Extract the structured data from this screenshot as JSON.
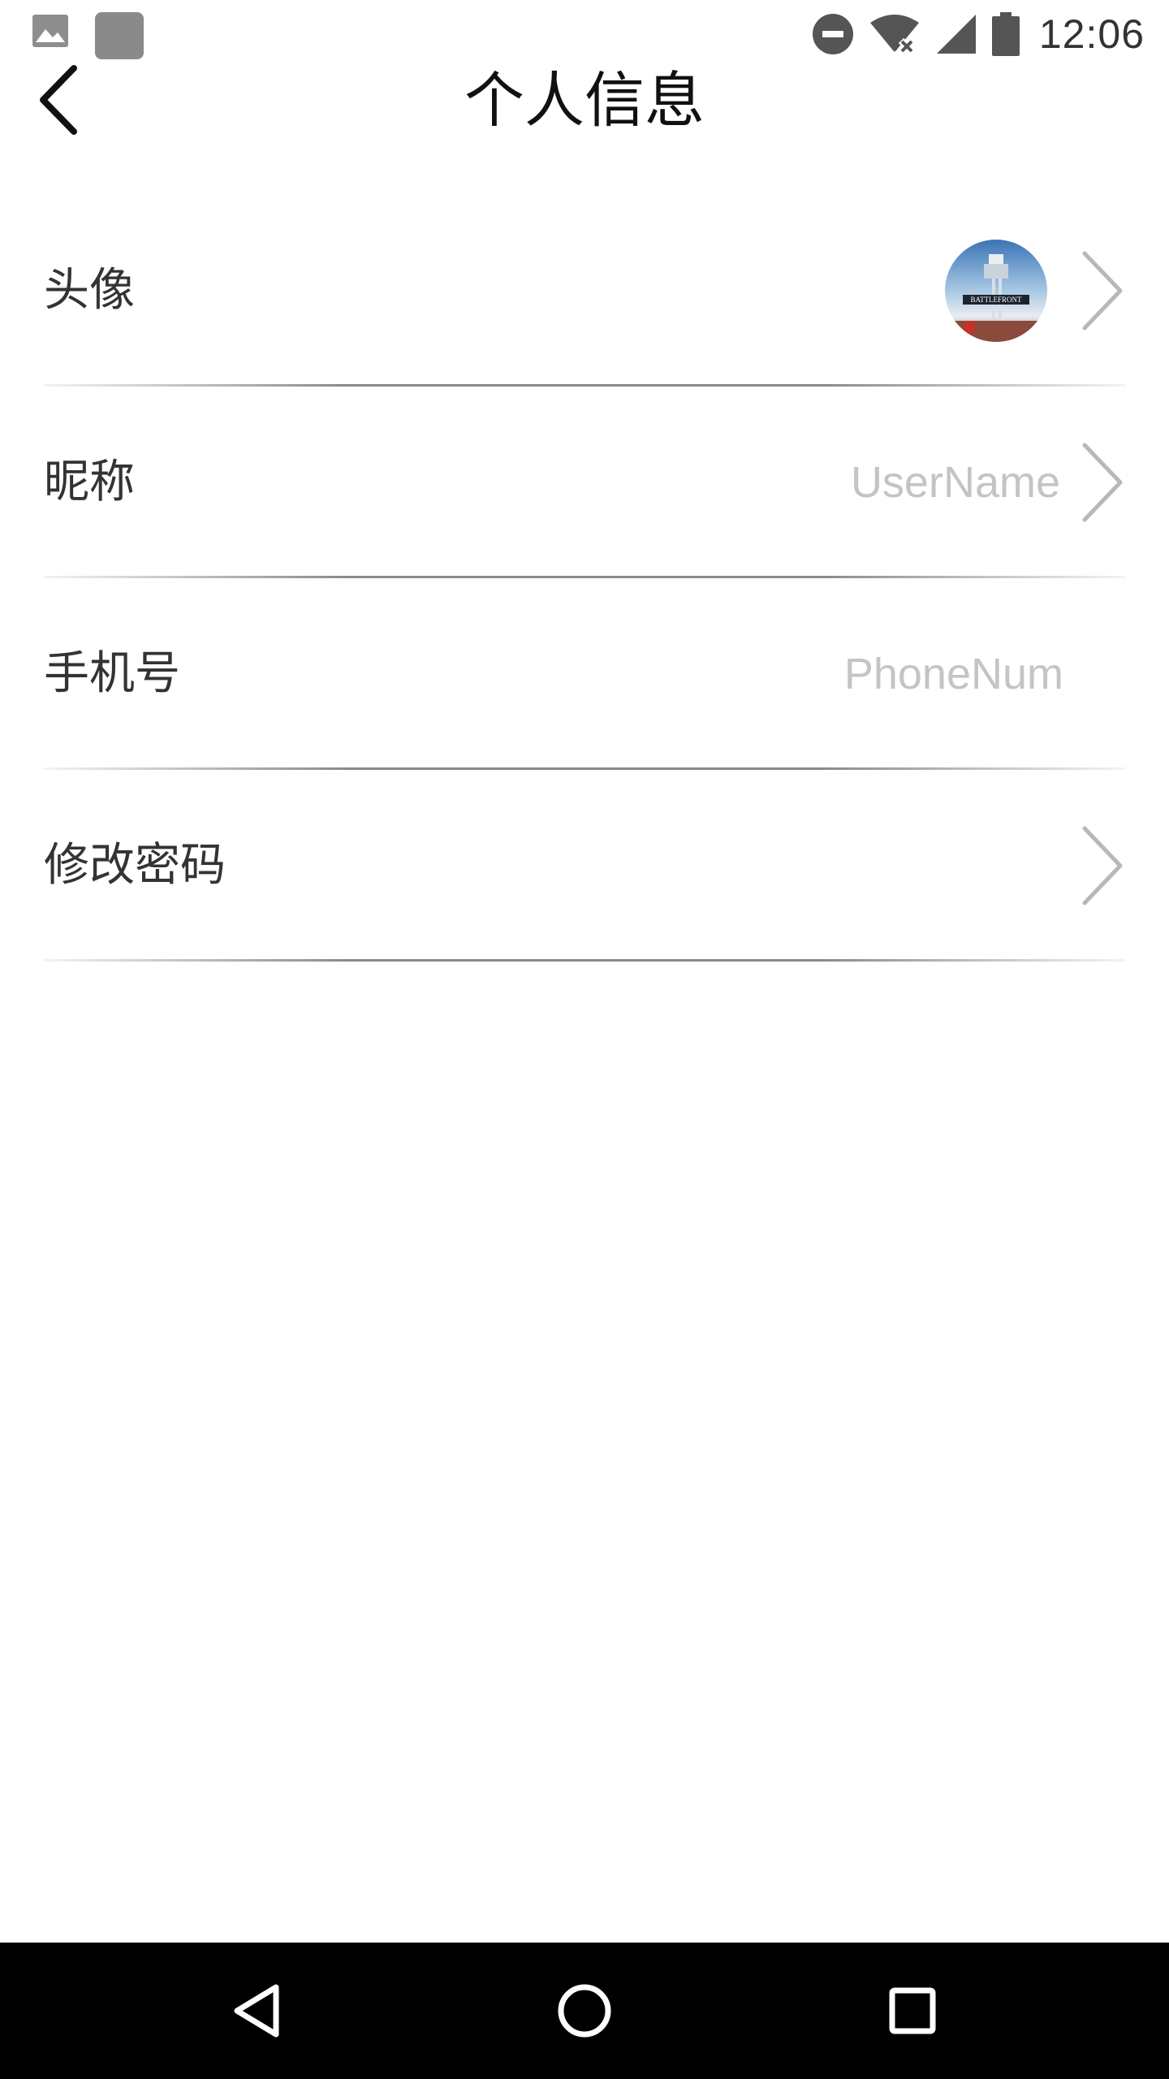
{
  "status_bar": {
    "time": "12:06",
    "icons": [
      "image-notification-icon",
      "app-notification-icon",
      "do-not-disturb-icon",
      "wifi-no-internet-icon",
      "cellular-signal-icon",
      "battery-icon"
    ]
  },
  "header": {
    "title": "个人信息",
    "back_icon": "chevron-left-icon"
  },
  "rows": [
    {
      "label": "头像",
      "value": "",
      "has_avatar": true,
      "has_chevron": true
    },
    {
      "label": "昵称",
      "value": "UserName",
      "has_avatar": false,
      "has_chevron": true
    },
    {
      "label": "手机号",
      "value": "PhoneNum",
      "has_avatar": false,
      "has_chevron": false
    },
    {
      "label": "修改密码",
      "value": "",
      "has_avatar": false,
      "has_chevron": true
    }
  ],
  "colors": {
    "background": "#ffffff",
    "label_text": "#333333",
    "placeholder_text": "#c4c4c4",
    "chevron": "#b8b8b8",
    "divider": "#8a8a8a",
    "nav_bar": "#000000"
  },
  "nav_bar": {
    "buttons": [
      "back-triangle-icon",
      "home-circle-icon",
      "recents-square-icon"
    ]
  }
}
